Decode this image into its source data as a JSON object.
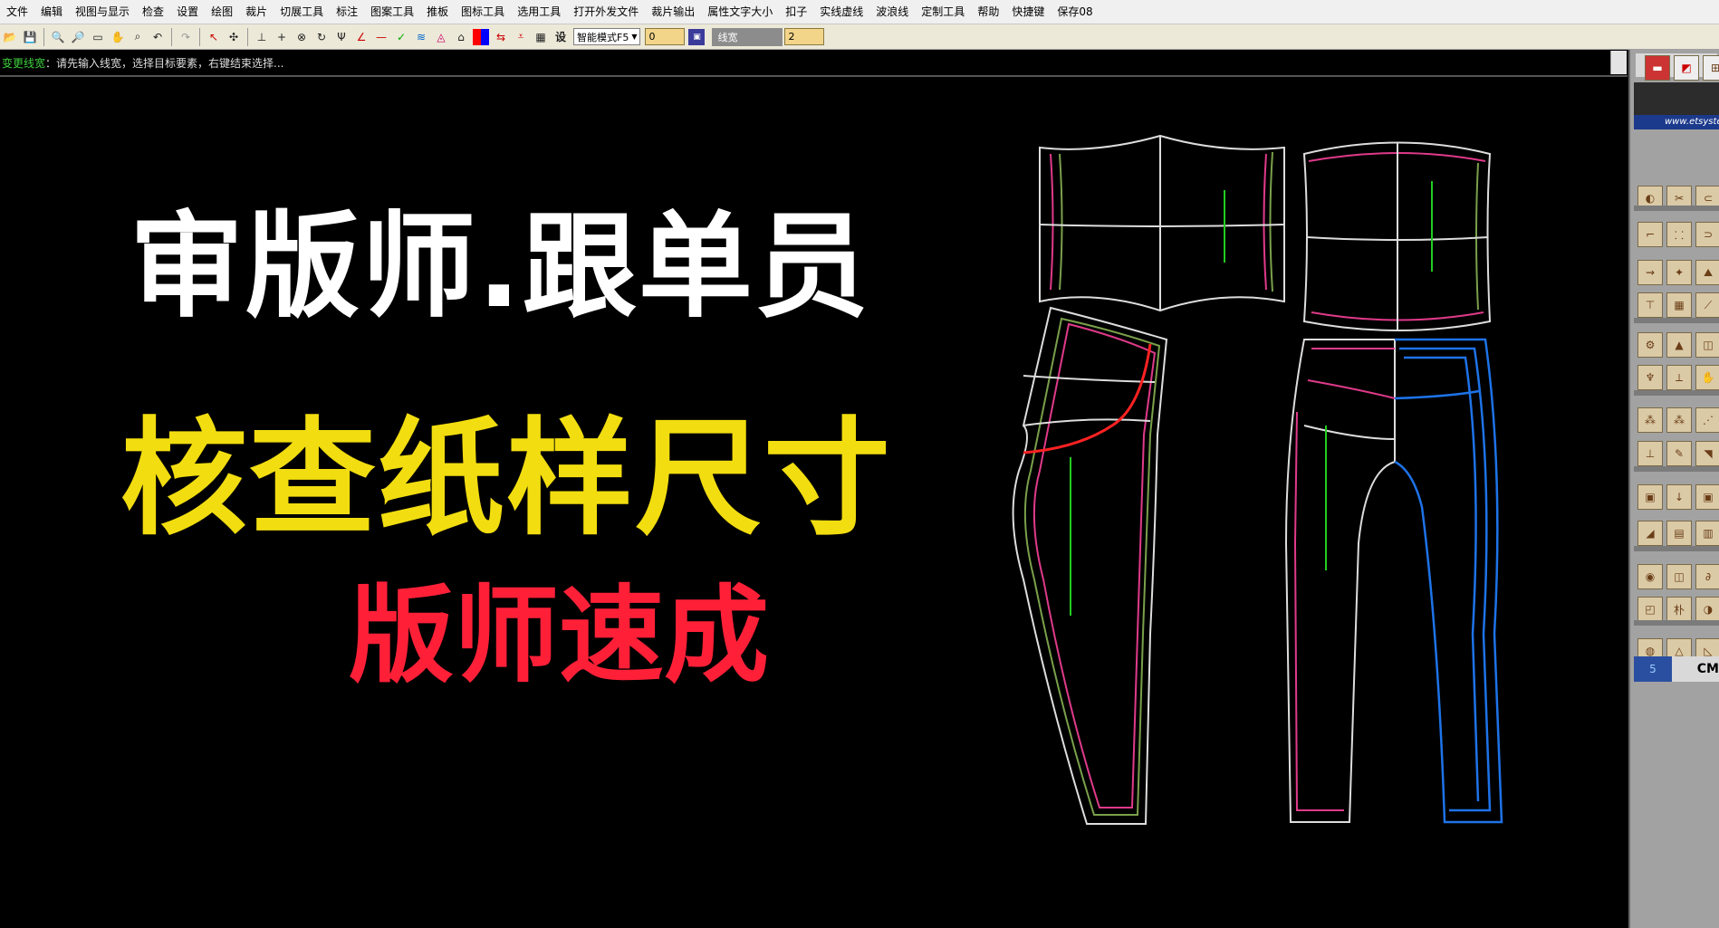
{
  "menu": [
    "文件",
    "编辑",
    "视图与显示",
    "检查",
    "设置",
    "绘图",
    "裁片",
    "切展工具",
    "标注",
    "图案工具",
    "推板",
    "图标工具",
    "选用工具",
    "打开外发文件",
    "裁片输出",
    "属性文字大小",
    "扣子",
    "实线虚线",
    "波浪线",
    "定制工具",
    "帮助",
    "快捷键",
    "保存08"
  ],
  "toolbar": {
    "mode_value": "智能模式F5",
    "num1_value": "0",
    "linewidth_label": "线宽",
    "linewidth_value": "2",
    "setting_label": "设"
  },
  "status": {
    "command": "变更线宽",
    "prompt": "：请先输入线宽，选择目标要素，右键结束选择..."
  },
  "overlay": {
    "line1": "审版师.跟单员",
    "line2": "核查纸样尺寸",
    "line3": "版师速成"
  },
  "panel": {
    "url_text": "www.etsyste",
    "page_number": "5",
    "unit_label": "CM"
  },
  "colors": {
    "line1": "#ffffff",
    "line2": "#f2dd10",
    "line3": "#ff2038"
  }
}
